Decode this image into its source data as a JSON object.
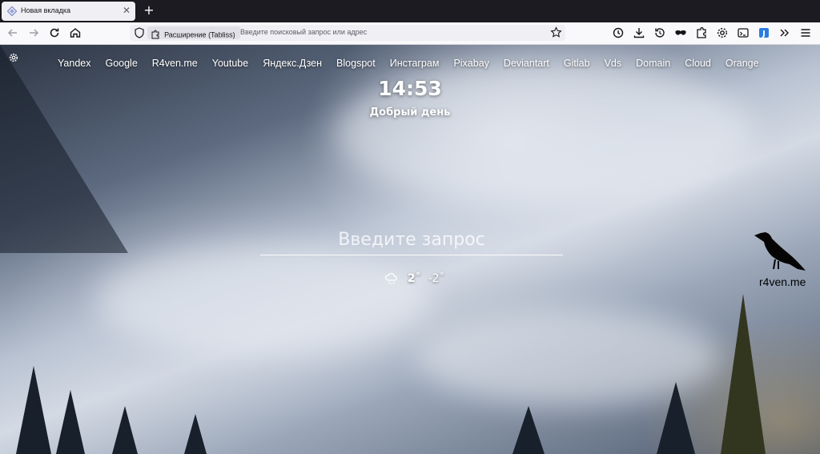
{
  "browser": {
    "tab": {
      "title": "Новая вкладка"
    },
    "urlbar": {
      "extension_chip": "Расширение (Tabliss)",
      "placeholder": "Введите поисковый запрос или адрес"
    }
  },
  "page": {
    "links": [
      "Yandex",
      "Google",
      "R4ven.me",
      "Youtube",
      "Яндекс.Дзен",
      "Blogspot",
      "Инстаграм",
      "Pixabay",
      "Deviantart",
      "Gitlab",
      "Vds",
      "Domain",
      "Cloud",
      "Orange"
    ],
    "clock": "14:53",
    "greeting": "Добрый день",
    "search": {
      "placeholder": "Введите запрос"
    },
    "weather": {
      "icon": "snow-cloud-icon",
      "high": "2˚",
      "low": "-2˚"
    },
    "watermark": "r4ven.me"
  },
  "colors": {
    "tabstrip": "#1c1b22",
    "navbar": "#f9f9fb",
    "text_light": "#ffffff"
  }
}
